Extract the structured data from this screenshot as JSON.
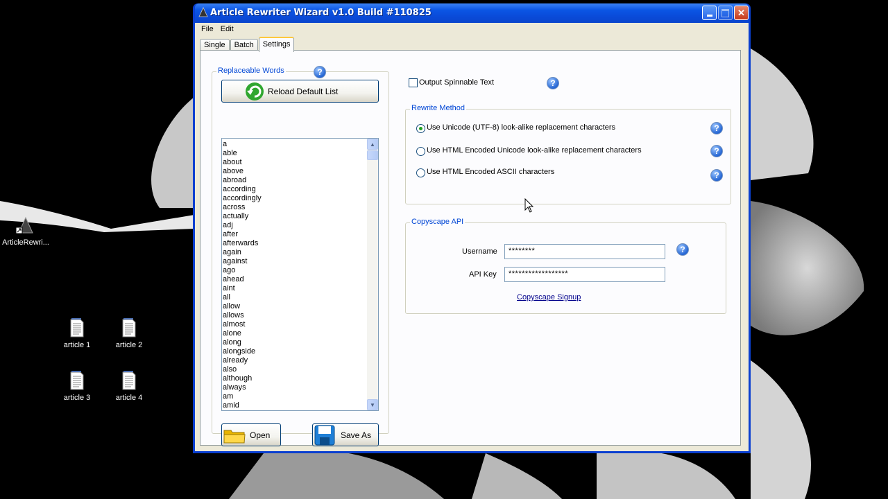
{
  "desktop": {
    "icons": [
      {
        "label": "ArticleRewri..."
      },
      {
        "label": "article 1"
      },
      {
        "label": "article 2"
      },
      {
        "label": "article 3"
      },
      {
        "label": "article 4"
      }
    ]
  },
  "window": {
    "title": "Article Rewriter Wizard v1.0 Build #110825",
    "menu": [
      "File",
      "Edit"
    ],
    "tabs": [
      "Single",
      "Batch",
      "Settings"
    ],
    "active_tab": "Settings"
  },
  "replaceable_words": {
    "group_title": "Replaceable Words",
    "reload_button": "Reload Default List",
    "words": [
      "a",
      "able",
      "about",
      "above",
      "abroad",
      "according",
      "accordingly",
      "across",
      "actually",
      "adj",
      "after",
      "afterwards",
      "again",
      "against",
      "ago",
      "ahead",
      "aint",
      "all",
      "allow",
      "allows",
      "almost",
      "alone",
      "along",
      "alongside",
      "already",
      "also",
      "although",
      "always",
      "am",
      "amid"
    ],
    "open_button": "Open",
    "save_as_button": "Save As"
  },
  "output": {
    "spinnable_label": "Output Spinnable Text",
    "spinnable_checked": false
  },
  "rewrite_method": {
    "group_title": "Rewrite Method",
    "options": [
      {
        "label": "Use Unicode (UTF-8) look-alike replacement characters",
        "checked": true
      },
      {
        "label": "Use HTML Encoded Unicode look-alike replacement characters",
        "checked": false
      },
      {
        "label": "Use HTML Encoded ASCII characters",
        "checked": false
      }
    ]
  },
  "copyscape": {
    "group_title": "Copyscape API",
    "username_label": "Username",
    "username_value": "********",
    "apikey_label": "API Key",
    "apikey_value": "******************",
    "signup_link": "Copyscape Signup"
  },
  "colors": {
    "titlebar": "#0b55e4",
    "client_bg": "#ece9d8",
    "group_title": "#0046d5",
    "link": "#00008b"
  }
}
